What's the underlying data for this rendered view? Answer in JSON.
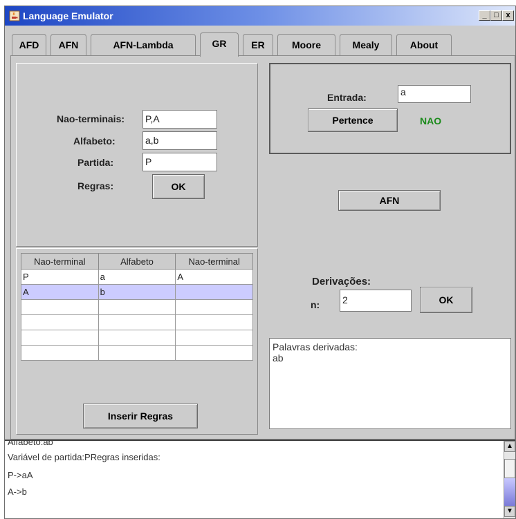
{
  "window": {
    "title": "Language Emulator",
    "min_glyph": "_",
    "max_glyph": "□",
    "close_glyph": "x"
  },
  "tabs": [
    {
      "label": "AFD"
    },
    {
      "label": "AFN"
    },
    {
      "label": "AFN-Lambda"
    },
    {
      "label": "GR"
    },
    {
      "label": "ER"
    },
    {
      "label": "Moore"
    },
    {
      "label": "Mealy"
    },
    {
      "label": "About"
    }
  ],
  "active_tab": "GR",
  "grammar": {
    "nonterminals_label": "Nao-terminais:",
    "nonterminals_value": "P,A",
    "alphabet_label": "Alfabeto:",
    "alphabet_value": "a,b",
    "start_label": "Partida:",
    "start_value": "P",
    "rules_label": "Regras:",
    "ok_label": "OK"
  },
  "rules_table": {
    "headers": [
      "Nao-terminal",
      "Alfabeto",
      "Nao-terminal"
    ],
    "rows": [
      [
        "P",
        "a",
        "A"
      ],
      [
        "A",
        "b",
        ""
      ],
      [
        "",
        "",
        ""
      ],
      [
        "",
        "",
        ""
      ],
      [
        "",
        "",
        ""
      ],
      [
        "",
        "",
        ""
      ]
    ],
    "selected_row": 1
  },
  "insert_rules_label": "Inserir Regras",
  "membership": {
    "input_label": "Entrada:",
    "input_value": "a",
    "button_label": "Pertence",
    "result": "NAO",
    "result_color": "#1a8a1a"
  },
  "afn_button_label": "AFN",
  "derivations": {
    "title": "Derivações:",
    "n_label": "n:",
    "n_value": "2",
    "ok_label": "OK",
    "output_lines": [
      "Palavras derivadas:",
      "ab"
    ]
  },
  "log": {
    "lines": [
      "Alfabeto:ab",
      "Variável de partida:PRegras inseridas:",
      "P->aA",
      "A->b"
    ]
  },
  "colors": {
    "title_bar": "#1d46c4",
    "window_bg": "#cccccc",
    "selection": "#ccccff"
  }
}
